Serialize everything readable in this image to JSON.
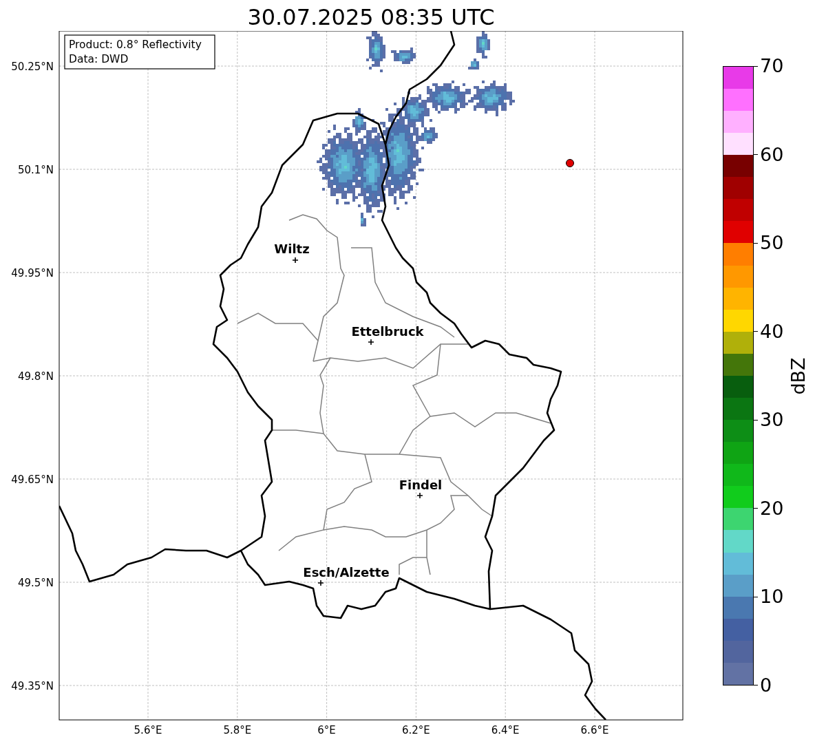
{
  "figure": {
    "title": "30.07.2025 08:35 UTC"
  },
  "map": {
    "info_box": [
      "Product: 0.8° Reflectivity",
      "Data: DWD"
    ],
    "lat_ticks": [
      "50.25°N",
      "50.1°N",
      "49.95°N",
      "49.8°N",
      "49.65°N",
      "49.5°N",
      "49.35°N"
    ],
    "lon_ticks": [
      "5.6°E",
      "5.8°E",
      "6°E",
      "6.2°E",
      "6.4°E",
      "6.6°E"
    ],
    "places": [
      {
        "name": "Wiltz"
      },
      {
        "name": "Ettelbruck"
      },
      {
        "name": "Findel"
      },
      {
        "name": "Esch/Alzette"
      }
    ]
  },
  "colorbar": {
    "label": "dBZ",
    "ticks": [
      "70",
      "60",
      "50",
      "40",
      "30",
      "20",
      "10",
      "0"
    ],
    "segments": [
      {
        "color": "#6272a4"
      },
      {
        "color": "#52659e"
      },
      {
        "color": "#4460a2"
      },
      {
        "color": "#4a78b0"
      },
      {
        "color": "#5a9ec8"
      },
      {
        "color": "#62bcd8"
      },
      {
        "color": "#62d8c8"
      },
      {
        "color": "#3dd570"
      },
      {
        "color": "#11cc1c"
      },
      {
        "color": "#10b81a"
      },
      {
        "color": "#0fa414"
      },
      {
        "color": "#0d8e16"
      },
      {
        "color": "#0b7612"
      },
      {
        "color": "#085e0e"
      },
      {
        "color": "#44760a"
      },
      {
        "color": "#b0b00a"
      },
      {
        "color": "#ffd700"
      },
      {
        "color": "#ffb400"
      },
      {
        "color": "#ff9800"
      },
      {
        "color": "#ff7e00"
      },
      {
        "color": "#e00000"
      },
      {
        "color": "#c00000"
      },
      {
        "color": "#a00000"
      },
      {
        "color": "#780000"
      },
      {
        "color": "#ffe0ff"
      },
      {
        "color": "#ffb0ff"
      },
      {
        "color": "#ff70ff"
      },
      {
        "color": "#e83ae8"
      }
    ]
  }
}
